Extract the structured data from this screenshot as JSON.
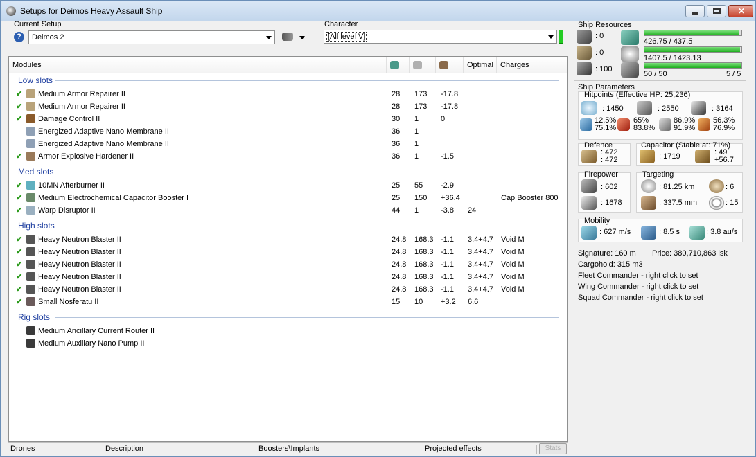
{
  "window": {
    "title": "Setups for Deimos Heavy Assault Ship"
  },
  "setup": {
    "label": "Current Setup",
    "value": "Deimos 2"
  },
  "character": {
    "label": "Character",
    "value": "[All level V]"
  },
  "table": {
    "headers": {
      "modules": "Modules",
      "optimal": "Optimal",
      "charges": "Charges"
    },
    "groups": [
      {
        "title": "Low slots",
        "rows": [
          {
            "checked": true,
            "name": "Medium Armor Repairer II",
            "v1": "28",
            "v2": "173",
            "v3": "-17.8",
            "optimal": "",
            "charges": "",
            "icon": "armor-repairer-icon",
            "color": "#b9a37a"
          },
          {
            "checked": true,
            "name": "Medium Armor Repairer II",
            "v1": "28",
            "v2": "173",
            "v3": "-17.8",
            "optimal": "",
            "charges": "",
            "icon": "armor-repairer-icon",
            "color": "#b9a37a"
          },
          {
            "checked": true,
            "name": "Damage Control II",
            "v1": "30",
            "v2": "1",
            "v3": "0",
            "optimal": "",
            "charges": "",
            "icon": "damage-control-icon",
            "color": "#8a5a2a"
          },
          {
            "checked": false,
            "name": "Energized Adaptive Nano Membrane II",
            "v1": "36",
            "v2": "1",
            "v3": "",
            "optimal": "",
            "charges": "",
            "icon": "membrane-icon",
            "color": "#8fa0b5"
          },
          {
            "checked": false,
            "name": "Energized Adaptive Nano Membrane II",
            "v1": "36",
            "v2": "1",
            "v3": "",
            "optimal": "",
            "charges": "",
            "icon": "membrane-icon",
            "color": "#8fa0b5"
          },
          {
            "checked": true,
            "name": "Armor Explosive Hardener II",
            "v1": "36",
            "v2": "1",
            "v3": "-1.5",
            "optimal": "",
            "charges": "",
            "icon": "hardener-icon",
            "color": "#9a7a5a"
          }
        ]
      },
      {
        "title": "Med slots",
        "rows": [
          {
            "checked": true,
            "name": "10MN Afterburner II",
            "v1": "25",
            "v2": "55",
            "v3": "-2.9",
            "optimal": "",
            "charges": "",
            "icon": "afterburner-icon",
            "color": "#5fb0c0"
          },
          {
            "checked": true,
            "name": "Medium Electrochemical Capacitor Booster I",
            "v1": "25",
            "v2": "150",
            "v3": "+36.4",
            "optimal": "",
            "charges": "Cap Booster 800",
            "icon": "cap-booster-icon",
            "color": "#6a8a6a"
          },
          {
            "checked": true,
            "name": "Warp Disruptor II",
            "v1": "44",
            "v2": "1",
            "v3": "-3.8",
            "optimal": "24",
            "charges": "",
            "icon": "warp-disruptor-icon",
            "color": "#9ab0c0"
          }
        ]
      },
      {
        "title": "High slots",
        "rows": [
          {
            "checked": true,
            "name": "Heavy Neutron Blaster II",
            "v1": "24.8",
            "v2": "168.3",
            "v3": "-1.1",
            "optimal": "3.4+4.7",
            "charges": "Void M",
            "icon": "blaster-icon",
            "color": "#555555"
          },
          {
            "checked": true,
            "name": "Heavy Neutron Blaster II",
            "v1": "24.8",
            "v2": "168.3",
            "v3": "-1.1",
            "optimal": "3.4+4.7",
            "charges": "Void M",
            "icon": "blaster-icon",
            "color": "#555555"
          },
          {
            "checked": true,
            "name": "Heavy Neutron Blaster II",
            "v1": "24.8",
            "v2": "168.3",
            "v3": "-1.1",
            "optimal": "3.4+4.7",
            "charges": "Void M",
            "icon": "blaster-icon",
            "color": "#555555"
          },
          {
            "checked": true,
            "name": "Heavy Neutron Blaster II",
            "v1": "24.8",
            "v2": "168.3",
            "v3": "-1.1",
            "optimal": "3.4+4.7",
            "charges": "Void M",
            "icon": "blaster-icon",
            "color": "#555555"
          },
          {
            "checked": true,
            "name": "Heavy Neutron Blaster II",
            "v1": "24.8",
            "v2": "168.3",
            "v3": "-1.1",
            "optimal": "3.4+4.7",
            "charges": "Void M",
            "icon": "blaster-icon",
            "color": "#555555"
          },
          {
            "checked": true,
            "name": "Small Nosferatu II",
            "v1": "15",
            "v2": "10",
            "v3": "+3.2",
            "optimal": "6.6",
            "charges": "",
            "icon": "nosferatu-icon",
            "color": "#6a5a5a"
          }
        ]
      },
      {
        "title": "Rig slots",
        "rows": [
          {
            "checked": false,
            "name": "Medium Ancillary Current Router II",
            "v1": "",
            "v2": "",
            "v3": "",
            "optimal": "",
            "charges": "",
            "icon": "rig-icon",
            "color": "#3a3a3a"
          },
          {
            "checked": false,
            "name": "Medium Auxiliary Nano Pump II",
            "v1": "",
            "v2": "",
            "v3": "",
            "optimal": "",
            "charges": "",
            "icon": "rig-icon",
            "color": "#3a3a3a"
          }
        ]
      }
    ]
  },
  "bottom_tabs": [
    "Drones",
    "Description",
    "Boosters\\Implants",
    "Projected effects"
  ],
  "stats_button": "Stats",
  "resources": {
    "title": "Ship Resources",
    "turret": ": 0",
    "launcher": ": 0",
    "drone_bay": ": 100",
    "cpu": {
      "text": "426.75 / 437.5",
      "fraction": 0.975
    },
    "power": {
      "text": "1407.5 / 1423.13",
      "fraction": 0.989
    },
    "calibration": {
      "text": "50 / 50",
      "fraction": 1.0
    },
    "rig_slots": "5 / 5"
  },
  "params": {
    "title": "Ship Parameters",
    "hitpoints_title": "Hitpoints (Effective HP: 25,236)",
    "shield": ": 1450",
    "armor": ": 2550",
    "structure": ": 3164",
    "res": [
      {
        "a": "12.5%",
        "b": "75.1%"
      },
      {
        "a": "65%",
        "b": "83.8%"
      },
      {
        "a": "86.9%",
        "b": "91.9%"
      },
      {
        "a": "56.3%",
        "b": "76.9%"
      }
    ],
    "defence_title": "Defence",
    "defence_a": ": 472",
    "defence_b": ": 472",
    "capacitor_title": "Capacitor (Stable at: 71%)",
    "cap_amount": ": 1719",
    "cap_a": ": 49",
    "cap_b": "+56.7",
    "firepower_title": "Firepower",
    "dps": ": 602",
    "volley": ": 1678",
    "targeting_title": "Targeting",
    "range": ": 81.25 km",
    "max_targets": ": 6",
    "scan_res": ": 337.5 mm",
    "sensor": ": 15",
    "mobility_title": "Mobility",
    "speed": ": 627 m/s",
    "align": ": 8.5 s",
    "warp": ": 3.8 au/s",
    "signature": "Signature: 160 m",
    "price": "Price: 380,710,863 isk",
    "cargohold": "Cargohold: 315 m3",
    "fleet": "Fleet Commander - right click to set",
    "wing": "Wing Commander - right click to set",
    "squad": "Squad Commander - right click to set"
  }
}
